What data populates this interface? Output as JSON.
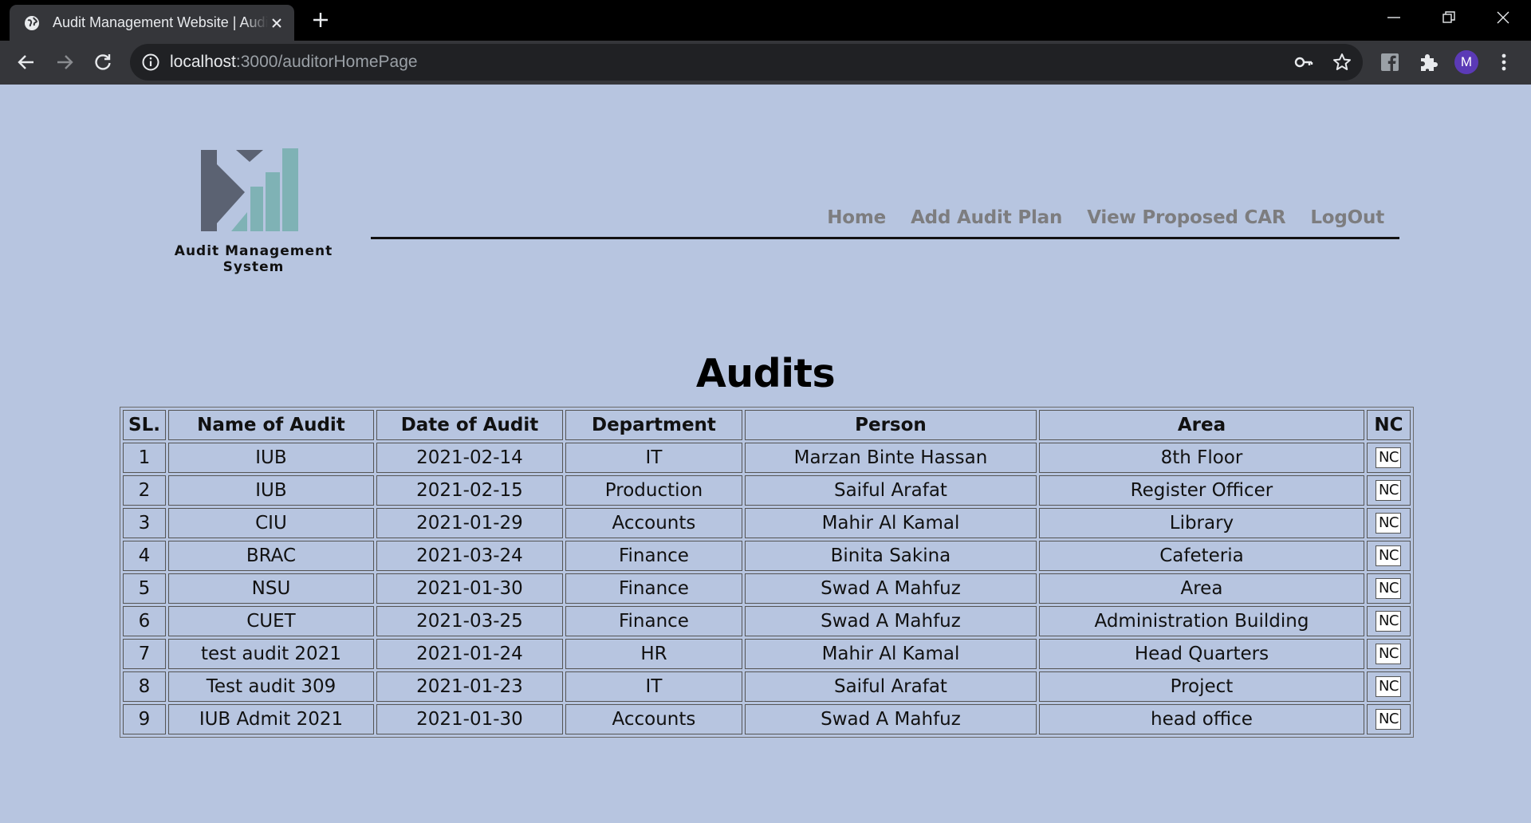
{
  "browser": {
    "tab_title": "Audit Management Website | Auditor",
    "url_host": "localhost",
    "url_path": ":3000/auditorHomePage",
    "avatar_letter": "M",
    "accent": "#5b3ab6"
  },
  "header": {
    "logo_caption": "Audit Management System",
    "nav": [
      {
        "label": "Home"
      },
      {
        "label": "Add Audit Plan"
      },
      {
        "label": "View Proposed CAR"
      },
      {
        "label": "LogOut"
      }
    ]
  },
  "main": {
    "title": "Audits",
    "columns": [
      "SL.",
      "Name of Audit",
      "Date of Audit",
      "Department",
      "Person",
      "Area",
      "NC"
    ],
    "rows": [
      {
        "sl": "1",
        "name": "IUB",
        "date": "2021-02-14",
        "department": "IT",
        "person": "Marzan Binte Hassan",
        "area": "8th Floor",
        "nc": "NC"
      },
      {
        "sl": "2",
        "name": "IUB",
        "date": "2021-02-15",
        "department": "Production",
        "person": "Saiful Arafat",
        "area": "Register Officer",
        "nc": "NC"
      },
      {
        "sl": "3",
        "name": "CIU",
        "date": "2021-01-29",
        "department": "Accounts",
        "person": "Mahir Al Kamal",
        "area": "Library",
        "nc": "NC"
      },
      {
        "sl": "4",
        "name": "BRAC",
        "date": "2021-03-24",
        "department": "Finance",
        "person": "Binita Sakina",
        "area": "Cafeteria",
        "nc": "NC"
      },
      {
        "sl": "5",
        "name": "NSU",
        "date": "2021-01-30",
        "department": "Finance",
        "person": "Swad A Mahfuz",
        "area": "Area",
        "nc": "NC"
      },
      {
        "sl": "6",
        "name": "CUET",
        "date": "2021-03-25",
        "department": "Finance",
        "person": "Swad A Mahfuz",
        "area": "Administration Building",
        "nc": "NC"
      },
      {
        "sl": "7",
        "name": "test audit 2021",
        "date": "2021-01-24",
        "department": "HR",
        "person": "Mahir Al Kamal",
        "area": "Head Quarters",
        "nc": "NC"
      },
      {
        "sl": "8",
        "name": "Test audit 309",
        "date": "2021-01-23",
        "department": "IT",
        "person": "Saiful Arafat",
        "area": "Project",
        "nc": "NC"
      },
      {
        "sl": "9",
        "name": "IUB Admit 2021",
        "date": "2021-01-30",
        "department": "Accounts",
        "person": "Swad A Mahfuz",
        "area": "head office",
        "nc": "NC"
      }
    ]
  },
  "colors": {
    "page_background": "#b7c5e0",
    "nav_link": "#7d7d7f",
    "logo_dark": "#5b6272",
    "logo_teal": "#7fb2b5"
  }
}
